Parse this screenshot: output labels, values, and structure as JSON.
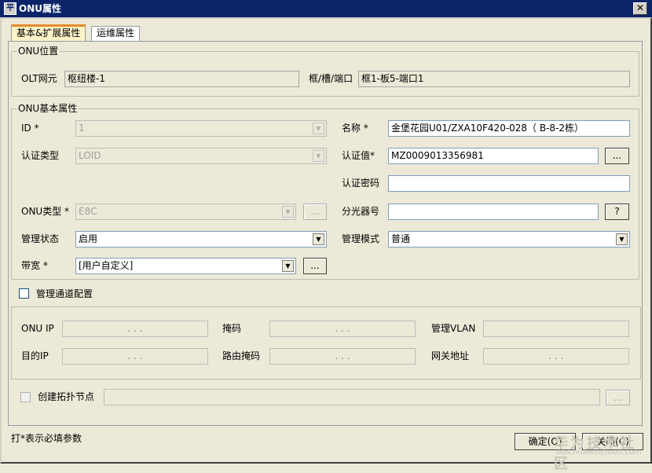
{
  "window": {
    "title": "ONU属性",
    "icon_glyph": "平",
    "close_glyph": "✕"
  },
  "tabs": [
    {
      "label": "基本&扩展属性",
      "active": true
    },
    {
      "label": "运维属性",
      "active": false
    }
  ],
  "onu_location": {
    "legend": "ONU位置",
    "olt_label": "OLT网元",
    "olt_value": "枢纽楼-1",
    "port_label": "框/槽/端口",
    "port_value": "框1-板5-端口1"
  },
  "onu_basic": {
    "legend": "ONU基本属性",
    "id_label": "ID *",
    "id_value": "1",
    "name_label": "名称 *",
    "name_value": "金堡花园U01/ZXA10F420-028（ B-8-2栋）",
    "auth_type_label": "认证类型",
    "auth_type_value": "LOID",
    "auth_value_label": "认证值*",
    "auth_value_value": "MZ0009013356981",
    "auth_pwd_label": "认证密码",
    "auth_pwd_value": "",
    "onu_type_label": "ONU类型 *",
    "onu_type_value": "E8C",
    "splitter_label": "分光器号",
    "splitter_value": "",
    "admin_state_label": "管理状态",
    "admin_state_value": "启用",
    "mgmt_mode_label": "管理模式",
    "mgmt_mode_value": "普通",
    "bandwidth_label": "带宽 *",
    "bandwidth_value": "[用户自定义]",
    "ellipsis": "...",
    "question": "?"
  },
  "mgmt_channel": {
    "checkbox_label": "管理通道配置",
    "checked": false,
    "onu_ip_label": "ONU IP",
    "mask_label": "掩码",
    "mgmt_vlan_label": "管理VLAN",
    "dest_ip_label": "目的IP",
    "route_mask_label": "路由掩码",
    "gateway_label": "网关地址",
    "ip_placeholder": ".        .        ."
  },
  "topology": {
    "checkbox_label": "创建拓扑节点",
    "checked": false,
    "ellipsis": "..."
  },
  "footer": {
    "required_hint": "打*表示必填参数",
    "ok_label": "确定(O)",
    "close_label": "关闭(C)"
  },
  "watermark": {
    "text": "华为技术社区",
    "url": "bbs.huaweicloud.com"
  },
  "colors": {
    "titlebar": "#0a246a",
    "tab_active": "#fdf3c8",
    "tab_accent": "#e68b2c",
    "dialog_bg": "#ece9d8"
  }
}
